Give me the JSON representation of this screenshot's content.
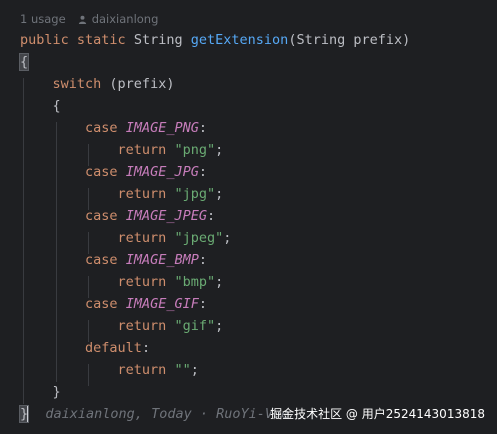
{
  "hint": {
    "usages": "1 usage",
    "author": "daixianlong"
  },
  "code": {
    "signature": {
      "public": "public",
      "static": "static",
      "return_type": "String",
      "method": "getExtension",
      "param_open": "(String prefix)"
    },
    "open_brace": "{",
    "switch_kw": "switch",
    "switch_expr": " (prefix)",
    "switch_open": "{",
    "cases": [
      {
        "case_kw": "case",
        "const": "IMAGE_PNG",
        "colon": ":",
        "return_kw": "return",
        "value": "\"png\"",
        "semi": ";"
      },
      {
        "case_kw": "case",
        "const": "IMAGE_JPG",
        "colon": ":",
        "return_kw": "return",
        "value": "\"jpg\"",
        "semi": ";"
      },
      {
        "case_kw": "case",
        "const": "IMAGE_JPEG",
        "colon": ":",
        "return_kw": "return",
        "value": "\"jpeg\"",
        "semi": ";"
      },
      {
        "case_kw": "case",
        "const": "IMAGE_BMP",
        "colon": ":",
        "return_kw": "return",
        "value": "\"bmp\"",
        "semi": ";"
      },
      {
        "case_kw": "case",
        "const": "IMAGE_GIF",
        "colon": ":",
        "return_kw": "return",
        "value": "\"gif\"",
        "semi": ";"
      }
    ],
    "default_kw": "default",
    "default_colon": ":",
    "default_return_kw": "return",
    "default_value": "\"\"",
    "default_semi": ";",
    "switch_close": "}",
    "close_brace": "}"
  },
  "blame": {
    "text": "daixianlong, Today · RuoYi-Vue"
  },
  "watermark": {
    "text": "掘金技术社区 @ 用户2524143013818"
  },
  "colors": {
    "background": "#1e1f22",
    "keyword": "#cf8e6d",
    "method": "#56a8f5",
    "constant": "#c77dbb",
    "string": "#6aab73",
    "text": "#bcbec4",
    "hint": "#6f737a"
  }
}
